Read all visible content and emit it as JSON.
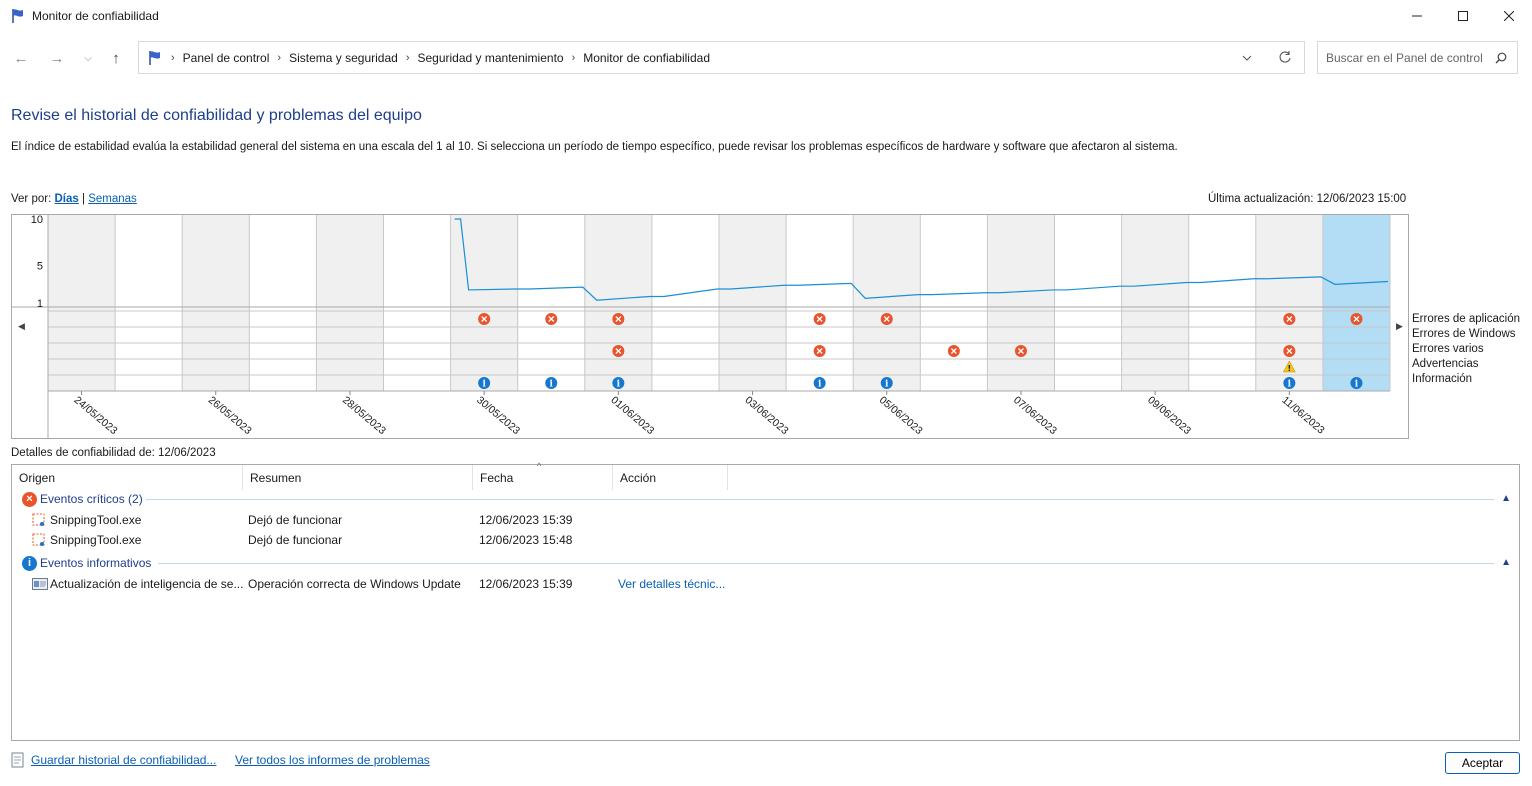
{
  "window": {
    "title": "Monitor de confiabilidad"
  },
  "nav": {
    "breadcrumbs": [
      "Panel de control",
      "Sistema y seguridad",
      "Seguridad y mantenimiento",
      "Monitor de confiabilidad"
    ],
    "search_placeholder": "Buscar en el Panel de control"
  },
  "page": {
    "heading": "Revise el historial de confiabilidad y problemas del equipo",
    "description": "El índice de estabilidad evalúa la estabilidad general del sistema en una escala del 1 al 10. Si selecciona un período de tiempo específico, puede revisar los problemas específicos de hardware y software que afectaron al sistema.",
    "view_by_label": "Ver por:",
    "view_days": "Días",
    "view_sep": "|",
    "view_weeks": "Semanas",
    "last_update": "Última actualización: 12/06/2023 15:00"
  },
  "chart_data": {
    "type": "line",
    "y_ticks": [
      "10",
      "5",
      "1"
    ],
    "ylim": [
      1,
      10
    ],
    "x_labels": [
      "24/05/2023",
      "26/05/2023",
      "28/05/2023",
      "30/05/2023",
      "01/06/2023",
      "03/06/2023",
      "05/06/2023",
      "07/06/2023",
      "09/06/2023",
      "11/06/2023"
    ],
    "days": [
      "24/05/2023",
      "25/05/2023",
      "26/05/2023",
      "27/05/2023",
      "28/05/2023",
      "29/05/2023",
      "30/05/2023",
      "31/05/2023",
      "01/06/2023",
      "02/06/2023",
      "03/06/2023",
      "04/06/2023",
      "05/06/2023",
      "06/06/2023",
      "07/06/2023",
      "08/06/2023",
      "09/06/2023",
      "10/06/2023",
      "11/06/2023",
      "12/06/2023"
    ],
    "selected_day": "12/06/2023",
    "stability_index": [
      null,
      null,
      null,
      null,
      null,
      null,
      2.4,
      2.5,
      1.3,
      1.7,
      2.5,
      2.9,
      1.5,
      1.9,
      2.1,
      2.4,
      2.8,
      3.2,
      3.6,
      3.0
    ],
    "categories": [
      "Errores de aplicación",
      "Errores de Windows",
      "Errores varios",
      "Advertencias",
      "Información"
    ],
    "events": {
      "Errores de aplicación": [
        "30/05/2023",
        "31/05/2023",
        "01/06/2023",
        "04/06/2023",
        "05/06/2023",
        "11/06/2023",
        "12/06/2023"
      ],
      "Errores de Windows": [],
      "Errores varios": [
        "01/06/2023",
        "04/06/2023",
        "06/06/2023",
        "07/06/2023",
        "11/06/2023"
      ],
      "Advertencias": [
        "11/06/2023"
      ],
      "Información": [
        "30/05/2023",
        "31/05/2023",
        "01/06/2023",
        "04/06/2023",
        "05/06/2023",
        "11/06/2023",
        "12/06/2023"
      ]
    },
    "colors": {
      "line": "#1a8fd6",
      "error": "#e8542c",
      "warning": "#f5c518",
      "info": "#1677cf",
      "selected": "#b3dcf5",
      "shade": "#f0f0f0"
    }
  },
  "details": {
    "label": "Detalles de confiabilidad de: 12/06/2023",
    "columns": [
      "Origen",
      "Resumen",
      "Fecha",
      "Acción"
    ],
    "groups": [
      {
        "title": "Eventos críticos (2)",
        "type": "error",
        "rows": [
          {
            "origin": "SnippingTool.exe",
            "summary": "Dejó de funcionar",
            "date": "12/06/2023 15:39",
            "action": ""
          },
          {
            "origin": "SnippingTool.exe",
            "summary": "Dejó de funcionar",
            "date": "12/06/2023 15:48",
            "action": ""
          }
        ]
      },
      {
        "title": "Eventos informativos",
        "type": "info",
        "rows": [
          {
            "origin": "Actualización de inteligencia de se...",
            "summary": "Operación correcta de Windows Update",
            "date": "12/06/2023 15:39",
            "action": "Ver detalles técnic..."
          }
        ]
      }
    ]
  },
  "footer": {
    "save_history": "Guardar historial de confiabilidad...",
    "view_reports": "Ver todos los informes de problemas",
    "ok": "Aceptar"
  }
}
